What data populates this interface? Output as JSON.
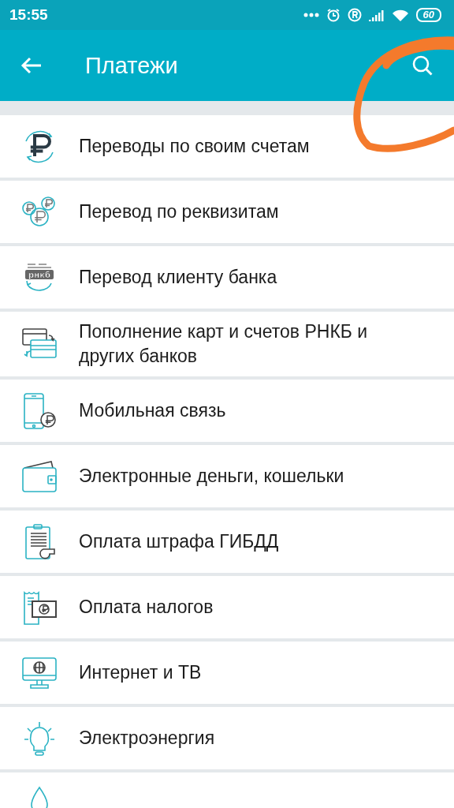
{
  "status_bar": {
    "time": "15:55",
    "battery": "60"
  },
  "app_bar": {
    "title": "Платежи"
  },
  "items": [
    {
      "label": "Переводы по своим счетам"
    },
    {
      "label": "Перевод по реквизитам"
    },
    {
      "label": "Перевод клиенту банка",
      "logo_text": "рнкб"
    },
    {
      "label": "Пополнение карт и счетов РНКБ и других банков"
    },
    {
      "label": "Мобильная связь"
    },
    {
      "label": "Электронные деньги, кошельки"
    },
    {
      "label": "Оплата штрафа ГИБДД"
    },
    {
      "label": "Оплата налогов"
    },
    {
      "label": "Интернет и ТВ"
    },
    {
      "label": "Электроэнергия"
    }
  ]
}
